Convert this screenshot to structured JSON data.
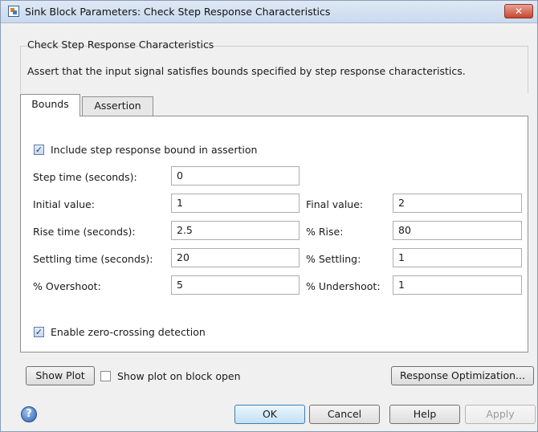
{
  "window": {
    "title": "Sink Block Parameters: Check Step Response Characteristics",
    "close_glyph": "✕"
  },
  "group": {
    "title": "Check Step Response Characteristics",
    "description": "Assert that the input signal satisfies bounds specified by step response characteristics."
  },
  "tabs": [
    {
      "label": "Bounds",
      "active": true
    },
    {
      "label": "Assertion",
      "active": false
    }
  ],
  "bounds": {
    "include_bound_label": "Include step response bound in assertion",
    "include_bound_checked": true,
    "step_time": {
      "label": "Step time (seconds):",
      "value": "0"
    },
    "initial_value": {
      "label": "Initial value:",
      "value": "1"
    },
    "final_value": {
      "label": "Final value:",
      "value": "2"
    },
    "rise_time": {
      "label": "Rise time (seconds):",
      "value": "2.5"
    },
    "pct_rise": {
      "label": "% Rise:",
      "value": "80"
    },
    "settling_time": {
      "label": "Settling time (seconds):",
      "value": "20"
    },
    "pct_settling": {
      "label": "% Settling:",
      "value": "1"
    },
    "pct_overshoot": {
      "label": "% Overshoot:",
      "value": "5"
    },
    "pct_undershoot": {
      "label": "% Undershoot:",
      "value": "1"
    },
    "zero_crossing_label": "Enable zero-crossing detection",
    "zero_crossing_checked": true
  },
  "plot": {
    "show_plot_label": "Show Plot",
    "show_on_open_label": "Show plot on block open",
    "show_on_open_checked": false,
    "response_optimization_label": "Response Optimization..."
  },
  "footer": {
    "help_icon_glyph": "?",
    "ok_label": "OK",
    "cancel_label": "Cancel",
    "help_label": "Help",
    "apply_label": "Apply"
  },
  "icons": {
    "app": "simulink-block-icon",
    "close": "close-icon",
    "help": "help-question-icon",
    "check": "checkmark-icon"
  },
  "colors": {
    "dialog_bg": "#f0f0f0",
    "titlebar": "#c9d9ee",
    "close_button": "#c9452e",
    "default_button_border": "#3c7fb1"
  }
}
